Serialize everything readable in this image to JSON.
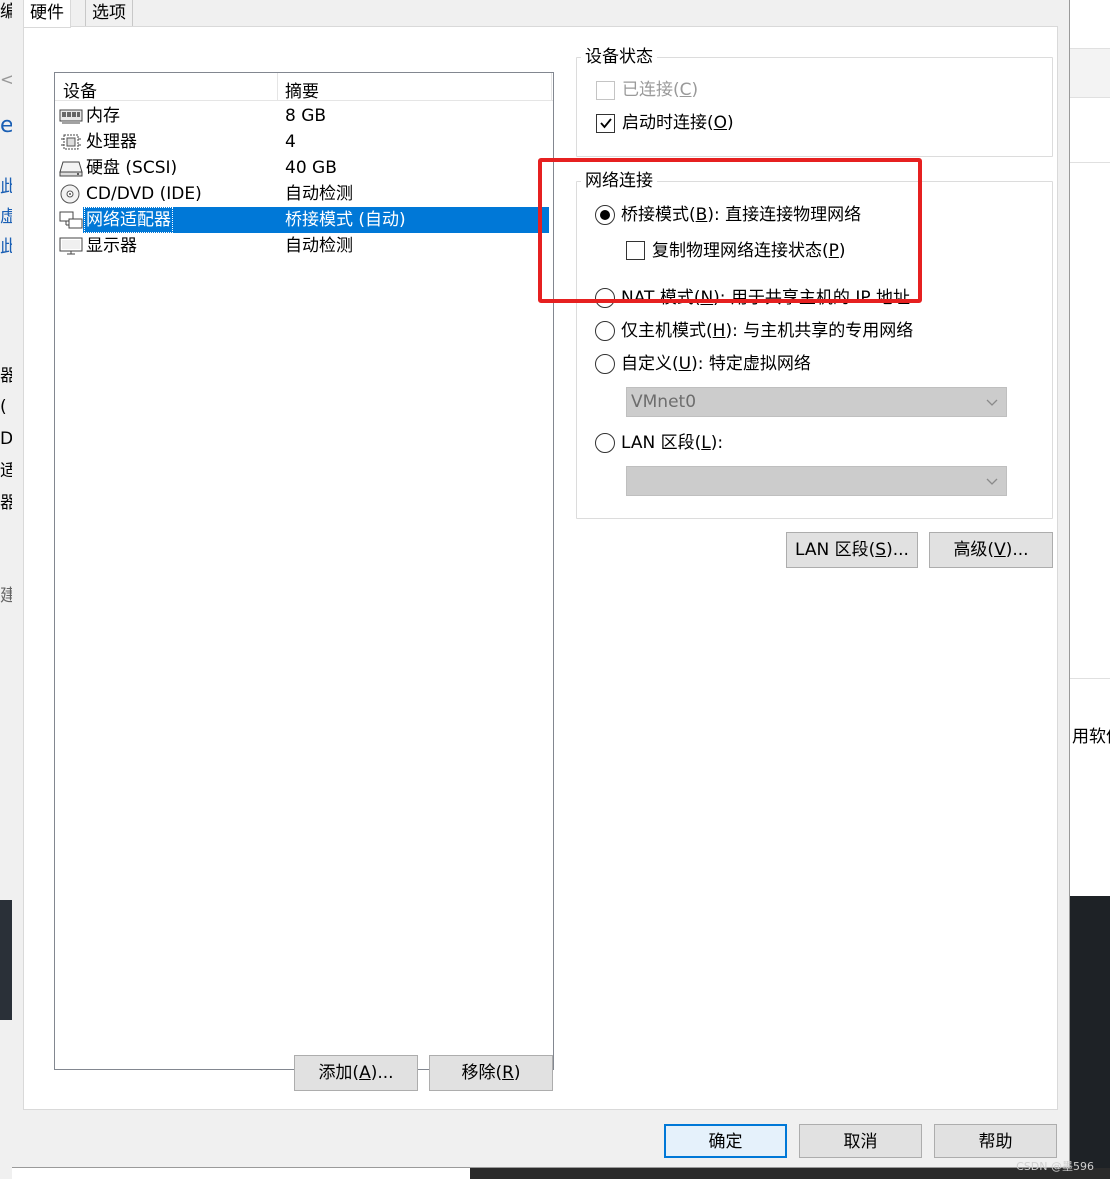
{
  "background": {
    "left_fragments": [
      {
        "text": "编",
        "blue": false
      },
      {
        "text": "<",
        "blue": false
      },
      {
        "text": "er",
        "blue": true
      },
      {
        "text": "此",
        "blue": true
      },
      {
        "text": "虚",
        "blue": true
      },
      {
        "text": "此",
        "blue": true
      },
      {
        "text": "器",
        "blue": false
      },
      {
        "text": "(",
        "blue": false
      },
      {
        "text": "D",
        "blue": false
      },
      {
        "text": "适",
        "blue": false
      },
      {
        "text": "器",
        "blue": false
      },
      {
        "text": "建",
        "blue": false
      }
    ],
    "right_fragment": "用软件",
    "watermark": "CSDN @墨596"
  },
  "dialog": {
    "tabs": [
      {
        "label": "硬件",
        "active": true
      },
      {
        "label": "选项",
        "active": false
      }
    ],
    "device_list": {
      "headers": {
        "device": "设备",
        "summary": "摘要"
      },
      "rows": [
        {
          "name": "内存",
          "summary": "8 GB",
          "icon": "memory-icon",
          "selected": false
        },
        {
          "name": "处理器",
          "summary": "4",
          "icon": "processor-icon",
          "selected": false
        },
        {
          "name": "硬盘 (SCSI)",
          "summary": "40 GB",
          "icon": "hard-disk-icon",
          "selected": false
        },
        {
          "name": "CD/DVD (IDE)",
          "summary": "自动检测",
          "icon": "cd-dvd-icon",
          "selected": false
        },
        {
          "name": "网络适配器",
          "summary": "桥接模式 (自动)",
          "icon": "network-adapter-icon",
          "selected": true
        },
        {
          "name": "显示器",
          "summary": "自动检测",
          "icon": "display-icon",
          "selected": false
        }
      ]
    },
    "list_buttons": {
      "add": {
        "pre": "添加(",
        "key": "A",
        "post": ")..."
      },
      "remove": {
        "pre": "移除(",
        "key": "R",
        "post": ")"
      }
    },
    "device_status": {
      "title": "设备状态",
      "connected": {
        "pre": "已连接(",
        "key": "C",
        "post": ")",
        "checked": false,
        "enabled": false
      },
      "connect_at_power_on": {
        "pre": "启动时连接(",
        "key": "O",
        "post": ")",
        "checked": true,
        "enabled": true
      }
    },
    "network_connection": {
      "title": "网络连接",
      "bridged": {
        "pre": "桥接模式(",
        "key": "B",
        "post": "): 直接连接物理网络",
        "selected": true
      },
      "replicate": {
        "pre": "复制物理网络连接状态(",
        "key": "P",
        "post": ")",
        "checked": false
      },
      "nat": {
        "pre": "NAT 模式(",
        "key": "N",
        "post": "): 用于共享主机的 IP 地址",
        "selected": false
      },
      "host_only": {
        "pre": "仅主机模式(",
        "key": "H",
        "post": "): 与主机共享的专用网络",
        "selected": false
      },
      "custom": {
        "pre": "自定义(",
        "key": "U",
        "post": "): 特定虚拟网络",
        "selected": false
      },
      "custom_combo_value": "VMnet0",
      "lan_segment": {
        "pre": "LAN 区段(",
        "key": "L",
        "post": "):",
        "selected": false
      },
      "lan_combo_value": ""
    },
    "network_buttons": {
      "lan_segments": {
        "pre": "LAN 区段(",
        "key": "S",
        "post": ")..."
      },
      "advanced": {
        "pre": "高级(",
        "key": "V",
        "post": ")..."
      }
    },
    "footer_buttons": {
      "ok": "确定",
      "cancel": "取消",
      "help": "帮助"
    },
    "annotation_color": "#e62020",
    "selection_color": "#0078d7"
  }
}
